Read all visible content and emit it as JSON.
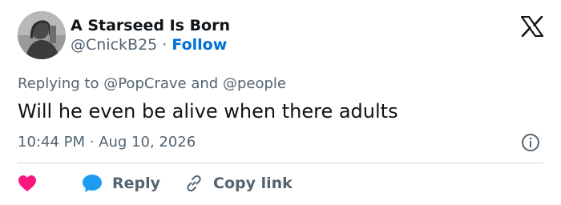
{
  "author": {
    "display_name": "A Starseed Is Born",
    "handle": "@CnickB25",
    "separator": "·",
    "follow_label": "Follow",
    "avatar_icon": "user-avatar-photo"
  },
  "reply_context": {
    "prefix": "Replying to",
    "mention1": "@PopCrave",
    "conjunction": "and",
    "mention2": "@people"
  },
  "tweet": {
    "text": "Will he even be alive when there adults"
  },
  "meta": {
    "time": "10:44 PM",
    "separator": "·",
    "date": "Aug 10, 2026"
  },
  "actions": {
    "like_icon": "heart-icon",
    "reply_label": "Reply",
    "copy_link_label": "Copy link"
  },
  "colors": {
    "like": "#f91880",
    "reply": "#1d9bf0",
    "follow": "#006fd6",
    "muted": "#536471",
    "text": "#0f1419"
  }
}
